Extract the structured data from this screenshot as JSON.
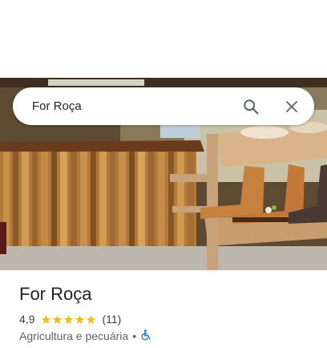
{
  "search": {
    "query": "For Roça"
  },
  "place": {
    "name": "For Roça",
    "rating": "4,9",
    "stars": 5,
    "review_count": "(11)",
    "category": "Agricultura e pecuária",
    "separator": "•",
    "accessibility_icon": "wheelchair-icon"
  },
  "colors": {
    "star": "#fbbc04",
    "accessible": "#1a73e8"
  }
}
